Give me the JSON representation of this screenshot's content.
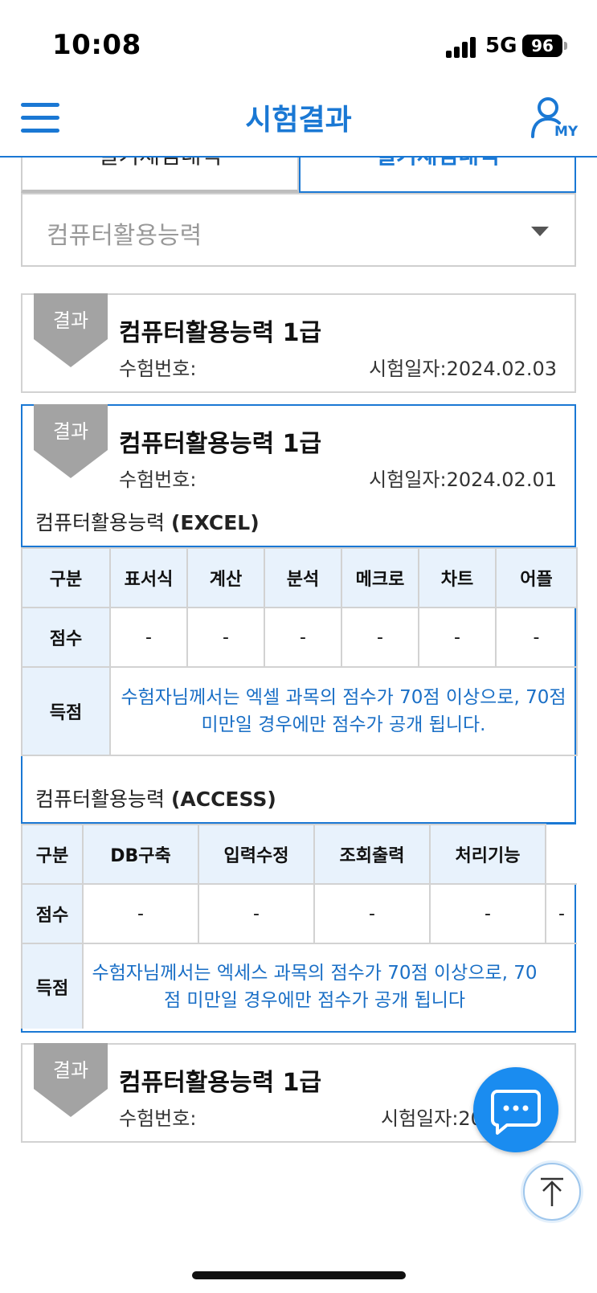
{
  "status": {
    "time": "10:08",
    "network": "5G",
    "battery": "96"
  },
  "header": {
    "title": "시험결과",
    "my_label": "MY"
  },
  "tabs": [
    {
      "label": "필기채점내역"
    },
    {
      "label": "실기채점내역"
    }
  ],
  "select": {
    "value": "컴퓨터활용능력"
  },
  "cards": [
    {
      "badge": "결과",
      "title": "컴퓨터활용능력 1급",
      "exam_no_label": "수험번호:",
      "exam_date_label": "시험일자:2024.02.03"
    },
    {
      "badge": "결과",
      "title": "컴퓨터활용능력 1급",
      "exam_no_label": "수험번호:",
      "exam_date_label": "시험일자:2024.02.01",
      "sections": [
        {
          "title_prefix": "컴퓨터활용능력 ",
          "title_bold": "(EXCEL)",
          "columns": [
            "구분",
            "표서식",
            "계산",
            "분석",
            "메크로",
            "차트",
            "어플"
          ],
          "score_label": "점수",
          "scores": [
            "-",
            "-",
            "-",
            "-",
            "-",
            "-"
          ],
          "total_label": "득점",
          "notice": "수험자님께서는 엑셀 과목의 점수가 70점 이상으로, 70점 미만일 경우에만 점수가 공개 됩니다."
        },
        {
          "title_prefix": "컴퓨터활용능력 ",
          "title_bold": "(ACCESS)",
          "columns": [
            "구분",
            "DB구축",
            "입력수정",
            "조회출력",
            "처리기능"
          ],
          "score_label": "점수",
          "scores": [
            "-",
            "-",
            "-",
            "-",
            "-"
          ],
          "total_label": "득점",
          "notice": "수험자님께서는 엑세스 과목의 점수가 70점 이상으로, 70점 미만일 경우에만 점수가 공개 됩니다"
        }
      ]
    },
    {
      "badge": "결과",
      "title": "컴퓨터활용능력 1급",
      "exam_no_label": "수험번호:",
      "exam_date_label": "시험일자:20"
    }
  ],
  "icons": {
    "menu": "hamburger-menu-icon",
    "my": "user-icon",
    "caret": "chevron-down-icon",
    "chat": "chat-bubble-icon",
    "top": "arrow-up-icon"
  },
  "colors": {
    "accent": "#1a78d4",
    "fab": "#1a8cf0",
    "notice": "#1a6fc6",
    "badge": "#a3a3a3",
    "table_head": "#e8f2fc"
  }
}
